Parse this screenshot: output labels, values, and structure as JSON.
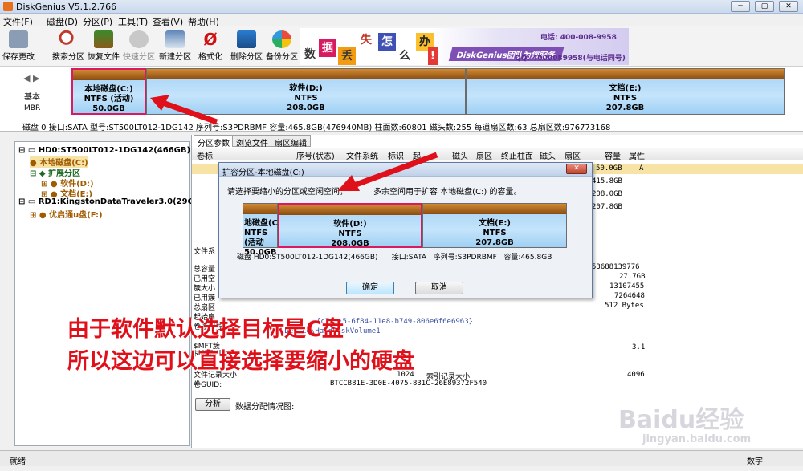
{
  "window": {
    "title": "DiskGenius V5.1.2.766"
  },
  "menu": [
    "文件(F)",
    "磁盘(D)",
    "分区(P)",
    "工具(T)",
    "查看(V)",
    "帮助(H)"
  ],
  "toolbar": [
    "保存更改",
    "搜索分区",
    "恢复文件",
    "快速分区",
    "新建分区",
    "格式化",
    "删除分区",
    "备份分区"
  ],
  "banner": {
    "chars": [
      "数",
      "据",
      "丢",
      "失",
      "怎",
      "么",
      "办",
      "!"
    ],
    "brand": "DiskGenius团队为您服务",
    "phone": "电话: 400-008-9958",
    "qq": "QQ: 4000089958(与电话同号)"
  },
  "diskmap": {
    "label_basic": "基本",
    "label_mbr": "MBR",
    "partitions": [
      {
        "name": "本地磁盘(C:)",
        "fs": "NTFS (活动)",
        "size": "50.0GB"
      },
      {
        "name": "软件(D:)",
        "fs": "NTFS",
        "size": "208.0GB"
      },
      {
        "name": "文档(E:)",
        "fs": "NTFS",
        "size": "207.8GB"
      }
    ],
    "info": "磁盘 0 接口:SATA  型号:ST500LT012-1DG142  序列号:S3PDRBMF  容量:465.8GB(476940MB)  柱面数:60801  磁头数:255  每道扇区数:63  总扇区数:976773168"
  },
  "tree": {
    "disk0": "HD0:ST500LT012-1DG142(466GB)",
    "c": "本地磁盘(C:)",
    "ext": "扩展分区",
    "d": "软件(D:)",
    "e": "文档(E:)",
    "disk1": "RD1:KingstonDataTraveler3.0(29GB",
    "f": "优启通u盘(F:)"
  },
  "tabs": [
    "分区参数",
    "浏览文件",
    "扇区编辑"
  ],
  "columns": [
    "卷标",
    "序号(状态)",
    "文件系统",
    "标识",
    "起",
    "磁头",
    "扇区",
    "终止柱面",
    "磁头",
    "扇区",
    "容量",
    "属性"
  ],
  "rows": [
    {
      "size": "50.0GB",
      "attr": "A"
    },
    {
      "size": "415.8GB"
    },
    {
      "size": "208.0GB"
    },
    {
      "size": "207.8GB"
    }
  ],
  "details": {
    "labels": [
      "文件系",
      "总容量",
      "已用空",
      "簇大小",
      "已用簇",
      "总扇区",
      "起始扇",
      "卷序列号",
      "$MFT簇",
      "$MFTMirr",
      "文件记录大小:",
      "卷GUID:"
    ],
    "values": [
      "53688139776",
      "27.7GB",
      "13107455",
      "7264648",
      "512 Bytes",
      "3.1",
      "4096"
    ],
    "guid": "{c7•••5-6f84-11e8-b749-806e6f6e6963}",
    "harddisk": "\\Device\\HarddiskVolume1",
    "record_size": "1024",
    "index_label": "索引记录大小:",
    "volguid": "BTCCB81E-3D0E-4075-831C-26E89372F540",
    "analyze": "分析",
    "distribution": "数据分配情况图:"
  },
  "dialog": {
    "title": "扩容分区-本地磁盘(C:)",
    "prompt": "请选择要缩小的分区或空闲空间，",
    "prompt_tail": "多余空间用于扩容 本地磁盘(C:) 的容量。",
    "parts": [
      {
        "name": "地磁盘(C",
        "fs": "NTFS (活动",
        "size": "50.0GB"
      },
      {
        "name": "软件(D:)",
        "fs": "NTFS",
        "size": "208.0GB"
      },
      {
        "name": "文档(E:)",
        "fs": "NTFS",
        "size": "207.8GB"
      }
    ],
    "info": "磁盘 HD0:ST500LT012-1DG142(466GB)      接口:SATA   序列号:S3PDRBMF   容量:465.8GB",
    "ok": "确定",
    "cancel": "取消"
  },
  "annotation": {
    "line1": "由于软件默认选择目标是C盘",
    "line2": "所以这边可以直接选择要缩小的硬盘"
  },
  "status": {
    "left": "就绪",
    "right": "数字"
  },
  "watermark": {
    "logo": "Baidu经验",
    "url": "jingyan.baidu.com"
  }
}
